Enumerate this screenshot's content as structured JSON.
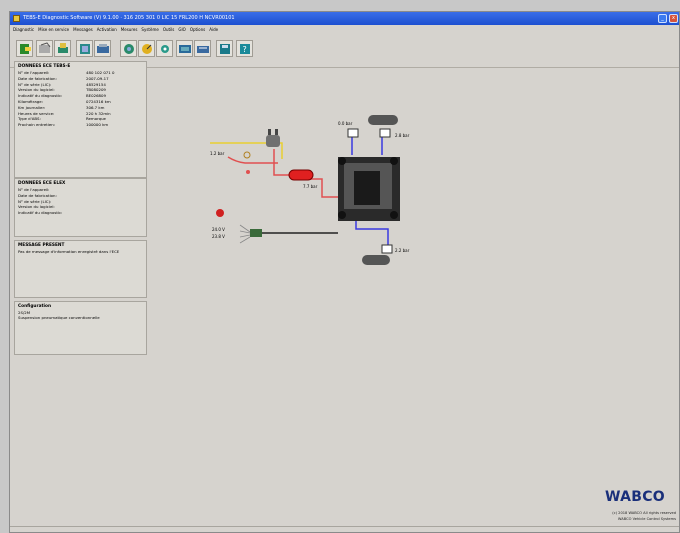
{
  "window": {
    "title": "TEBS-E Diagnostic Software (V) 9.1.00 · 316 205 301 0 LIC 15 FRL200 H NCVR00101"
  },
  "menu": [
    "Diagnostic",
    "Mise en service",
    "Messages",
    "Activation",
    "Mesures",
    "Système",
    "Outils",
    "GIO",
    "Options",
    "Aide"
  ],
  "toolbar_icons": [
    "exit-icon",
    "open-icon",
    "print-icon",
    "ecu-read-icon",
    "ecu-write-icon",
    "diagnosis-icon",
    "measure-icon",
    "settings-icon",
    "ecu-data-icon",
    "transfer-icon",
    "save-icon",
    "help-icon"
  ],
  "panels": {
    "ecu_tebs": {
      "title": "DONNEES ECE TEBS-E",
      "rows": [
        {
          "k": "N° de l'appareil:",
          "v": "480 102 071 0"
        },
        {
          "k": "Date de fabrication:",
          "v": "2007-09-17"
        },
        {
          "k": "N° de série (LIC):",
          "v": "48529154"
        },
        {
          "k": "Version du logiciel:",
          "v": "TB080209"
        },
        {
          "k": "Indicatif du diagnostic:",
          "v": "BE026809"
        },
        {
          "k": "Kilométrage:",
          "v": "0724316 km"
        },
        {
          "k": "Km journalier:",
          "v": "306.7 km"
        },
        {
          "k": "Heures de service:",
          "v": "220 h 32min"
        },
        {
          "k": "Type d'ABS:",
          "v": "Remorque"
        },
        {
          "k": "Prochain entretien:",
          "v": "100000 km"
        }
      ]
    },
    "ecu_elex": {
      "title": "DONNEES ECE ELEX",
      "rows": [
        {
          "k": "N° de l'appareil:",
          "v": ""
        },
        {
          "k": "Date de fabrication:",
          "v": ""
        },
        {
          "k": "N° de série (LIC):",
          "v": ""
        },
        {
          "k": "Version du logiciel:",
          "v": ""
        },
        {
          "k": "Indicatif du diagnostic:",
          "v": ""
        }
      ]
    },
    "message": {
      "title": "MESSAGE PRESENT",
      "text": "Pas de message d'information enregistré dans l'ECE"
    },
    "config": {
      "title": "Configuration",
      "line1": "2S/2M",
      "line2": "Suspension pneumatique conventionnelle"
    }
  },
  "diagram": {
    "pressure_supply": "1.2 bar",
    "pressure_reservoir": "7.7 bar",
    "pressure_top_left": "0.0 bar",
    "pressure_top_right": "2.8 bar",
    "pressure_bottom": "2.2 bar",
    "voltage_1": "24.0 V",
    "voltage_2": "23.8 V",
    "colors": {
      "supply_line": "#e05050",
      "control_line": "#e8d030",
      "brake_line": "#3a3ae0",
      "reservoir": "#e02020"
    }
  },
  "brand": {
    "logo": "WABCO",
    "copyright": "(c) 2018 WABCO All rights reserved",
    "subtitle": "WABCO Vehicle Control Systems"
  }
}
